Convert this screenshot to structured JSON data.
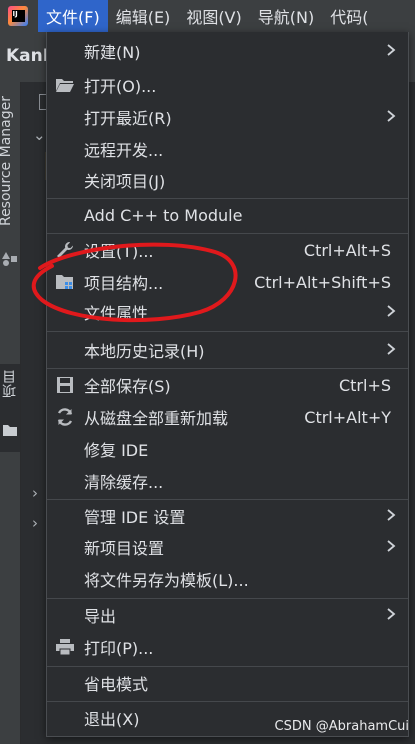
{
  "menubar": {
    "logo": "IJ",
    "items": [
      "文件(F)",
      "编辑(E)",
      "视图(V)",
      "导航(N)",
      "代码("
    ]
  },
  "titlebar": {
    "project": "KanM"
  },
  "side_panels": {
    "resource_manager": "Resource Manager",
    "project": "项目"
  },
  "file_menu": {
    "new": {
      "label": "新建(N)"
    },
    "open": {
      "label": "打开(O)..."
    },
    "open_recent": {
      "label": "打开最近(R)"
    },
    "remote_dev": {
      "label": "远程开发..."
    },
    "close_project": {
      "label": "关闭项目(J)"
    },
    "add_cpp": {
      "label": "Add C++ to Module"
    },
    "settings": {
      "label": "设置(T)...",
      "shortcut": "Ctrl+Alt+S"
    },
    "project_structure": {
      "label": "项目结构...",
      "shortcut": "Ctrl+Alt+Shift+S"
    },
    "file_properties": {
      "label": "文件属性"
    },
    "local_history": {
      "label": "本地历史记录(H)"
    },
    "save_all": {
      "label": "全部保存(S)",
      "shortcut": "Ctrl+S"
    },
    "reload_all": {
      "label": "从磁盘全部重新加载",
      "shortcut": "Ctrl+Alt+Y"
    },
    "repair_ide": {
      "label": "修复 IDE"
    },
    "invalidate_caches": {
      "label": "清除缓存..."
    },
    "manage_ide_settings": {
      "label": "管理 IDE 设置"
    },
    "new_project_settings": {
      "label": "新项目设置"
    },
    "save_as_template": {
      "label": "将文件另存为模板(L)..."
    },
    "export": {
      "label": "导出"
    },
    "print": {
      "label": "打印(P)..."
    },
    "power_save": {
      "label": "省电模式"
    },
    "exit": {
      "label": "退出(X)"
    }
  },
  "watermark": "CSDN @AbrahamCui",
  "colors": {
    "menubar_active": "#2f65ca",
    "menu_bg": "#2b2d30",
    "annotation": "#e0191c"
  }
}
